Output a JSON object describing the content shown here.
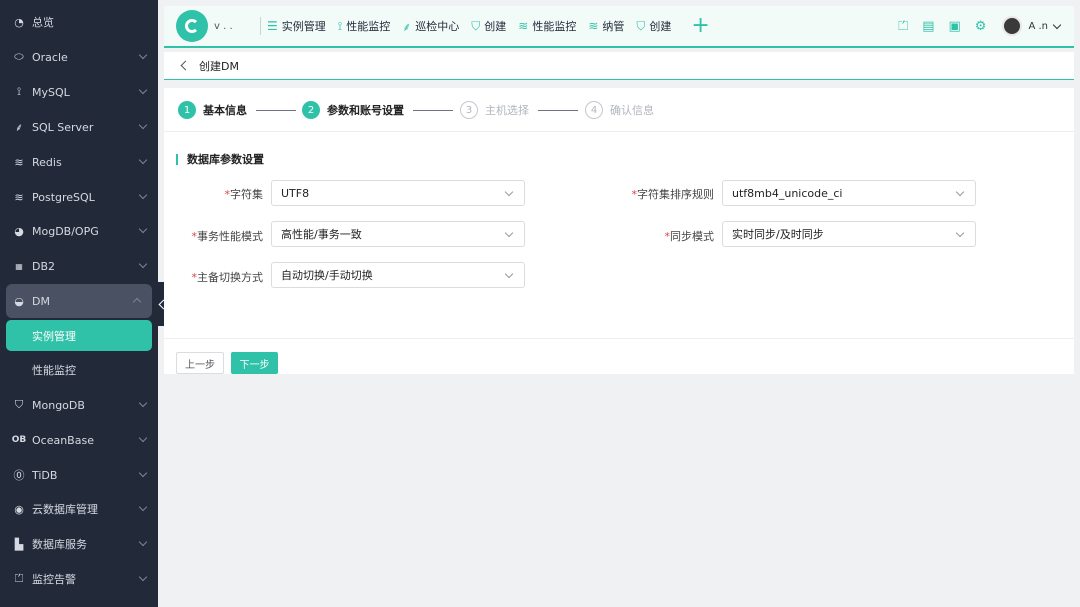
{
  "sidebar": {
    "items": [
      {
        "label": "总览",
        "icon": "dashboard-icon"
      },
      {
        "label": "Oracle",
        "icon": "oracle-icon"
      },
      {
        "label": "MySQL",
        "icon": "dolphin-icon"
      },
      {
        "label": "SQL Server",
        "icon": "sqlserver-icon"
      },
      {
        "label": "Redis",
        "icon": "layers-icon"
      },
      {
        "label": "PostgreSQL",
        "icon": "layers-icon"
      },
      {
        "label": "MogDB/OPG",
        "icon": "mogdb-icon"
      },
      {
        "label": "DB2",
        "icon": "db2-icon"
      },
      {
        "label": "DM",
        "icon": "dm-icon"
      },
      {
        "label": "MongoDB",
        "icon": "shield-icon"
      },
      {
        "label": "OceanBase",
        "icon": "oceanbase-icon"
      },
      {
        "label": "TiDB",
        "icon": "tidb-icon"
      },
      {
        "label": "云数据库管理",
        "icon": "cloud-icon"
      },
      {
        "label": "数据库服务",
        "icon": "bar-icon"
      },
      {
        "label": "监控告警",
        "icon": "alarm-icon"
      }
    ],
    "dm_children": [
      {
        "label": "实例管理"
      },
      {
        "label": "性能监控"
      }
    ]
  },
  "topbar": {
    "logo_text": "v . .",
    "nav": [
      {
        "label": "实例管理",
        "icon": "list-icon"
      },
      {
        "label": "性能监控",
        "icon": "dolphin-icon"
      },
      {
        "label": "巡检中心",
        "icon": "sqlserver-icon"
      },
      {
        "label": "创建",
        "icon": "redis-icon"
      },
      {
        "label": "性能监控",
        "icon": "layers-icon"
      },
      {
        "label": "纳管",
        "icon": "layers-icon"
      },
      {
        "label": "创建",
        "icon": "shield-icon"
      }
    ],
    "user_name": "A  .n"
  },
  "breadcrumb": {
    "title": "创建DM"
  },
  "steps": [
    {
      "num": "1",
      "label": "基本信息",
      "state": "done"
    },
    {
      "num": "2",
      "label": "参数和账号设置",
      "state": "current"
    },
    {
      "num": "3",
      "label": "主机选择",
      "state": "pending"
    },
    {
      "num": "4",
      "label": "确认信息",
      "state": "pending"
    }
  ],
  "section": {
    "title": "数据库参数设置"
  },
  "form": {
    "charset": {
      "label": "字符集",
      "value": "UTF8"
    },
    "collation": {
      "label": "字符集排序规则",
      "value": "utf8mb4_unicode_ci"
    },
    "txn_mode": {
      "label": "事务性能模式",
      "value": "高性能/事务一致"
    },
    "sync_mode": {
      "label": "同步模式",
      "value": "实时同步/及时同步"
    },
    "switch_mode": {
      "label": "主备切换方式",
      "value": "自动切换/手动切换"
    },
    "required_mark": "*"
  },
  "buttons": {
    "prev": "上一步",
    "next": "下一步"
  },
  "colors": {
    "accent": "#2fc2a8",
    "sidebar_bg": "#222a3a"
  }
}
